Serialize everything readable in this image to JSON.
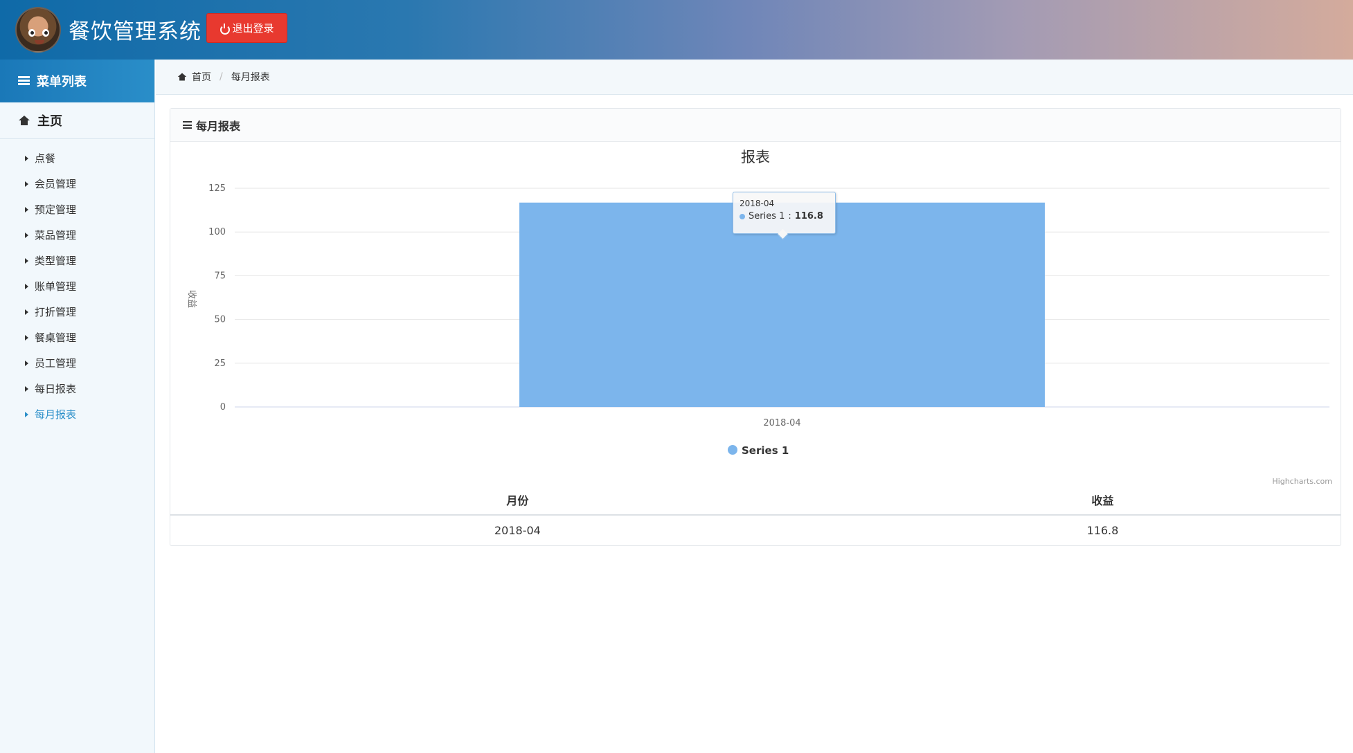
{
  "app": {
    "title": "餐饮管理系统",
    "logout_label": "退出登录"
  },
  "sidebar": {
    "header": "菜单列表",
    "home": "主页",
    "items": [
      {
        "label": "点餐"
      },
      {
        "label": "会员管理"
      },
      {
        "label": "预定管理"
      },
      {
        "label": "菜品管理"
      },
      {
        "label": "类型管理"
      },
      {
        "label": "账单管理"
      },
      {
        "label": "打折管理"
      },
      {
        "label": "餐桌管理"
      },
      {
        "label": "员工管理"
      },
      {
        "label": "每日报表"
      },
      {
        "label": "每月报表",
        "active": true
      }
    ]
  },
  "breadcrumb": {
    "home": "首页",
    "current": "每月报表"
  },
  "panel": {
    "title": "每月报表",
    "credits": "Highcharts.com"
  },
  "tooltip": {
    "category": "2018-04",
    "series": "Series 1",
    "separator": ": ",
    "value": "116.8"
  },
  "chart_data": {
    "type": "bar",
    "title": "报表",
    "categories": [
      "2018-04"
    ],
    "series": [
      {
        "name": "Series 1",
        "values": [
          116.8
        ]
      }
    ],
    "ylabel": "收益",
    "ylim": [
      0,
      125
    ],
    "yticks": [
      0,
      25,
      50,
      75,
      100,
      125
    ],
    "grid": true,
    "legend": "bottom-center",
    "color": "#7cb5ec"
  },
  "table": {
    "headers": [
      "月份",
      "收益"
    ],
    "rows": [
      [
        "2018-04",
        "116.8"
      ]
    ]
  },
  "colors": {
    "accent": "#2b8fc9",
    "logout": "#e8392f",
    "series": "#7cb5ec"
  }
}
